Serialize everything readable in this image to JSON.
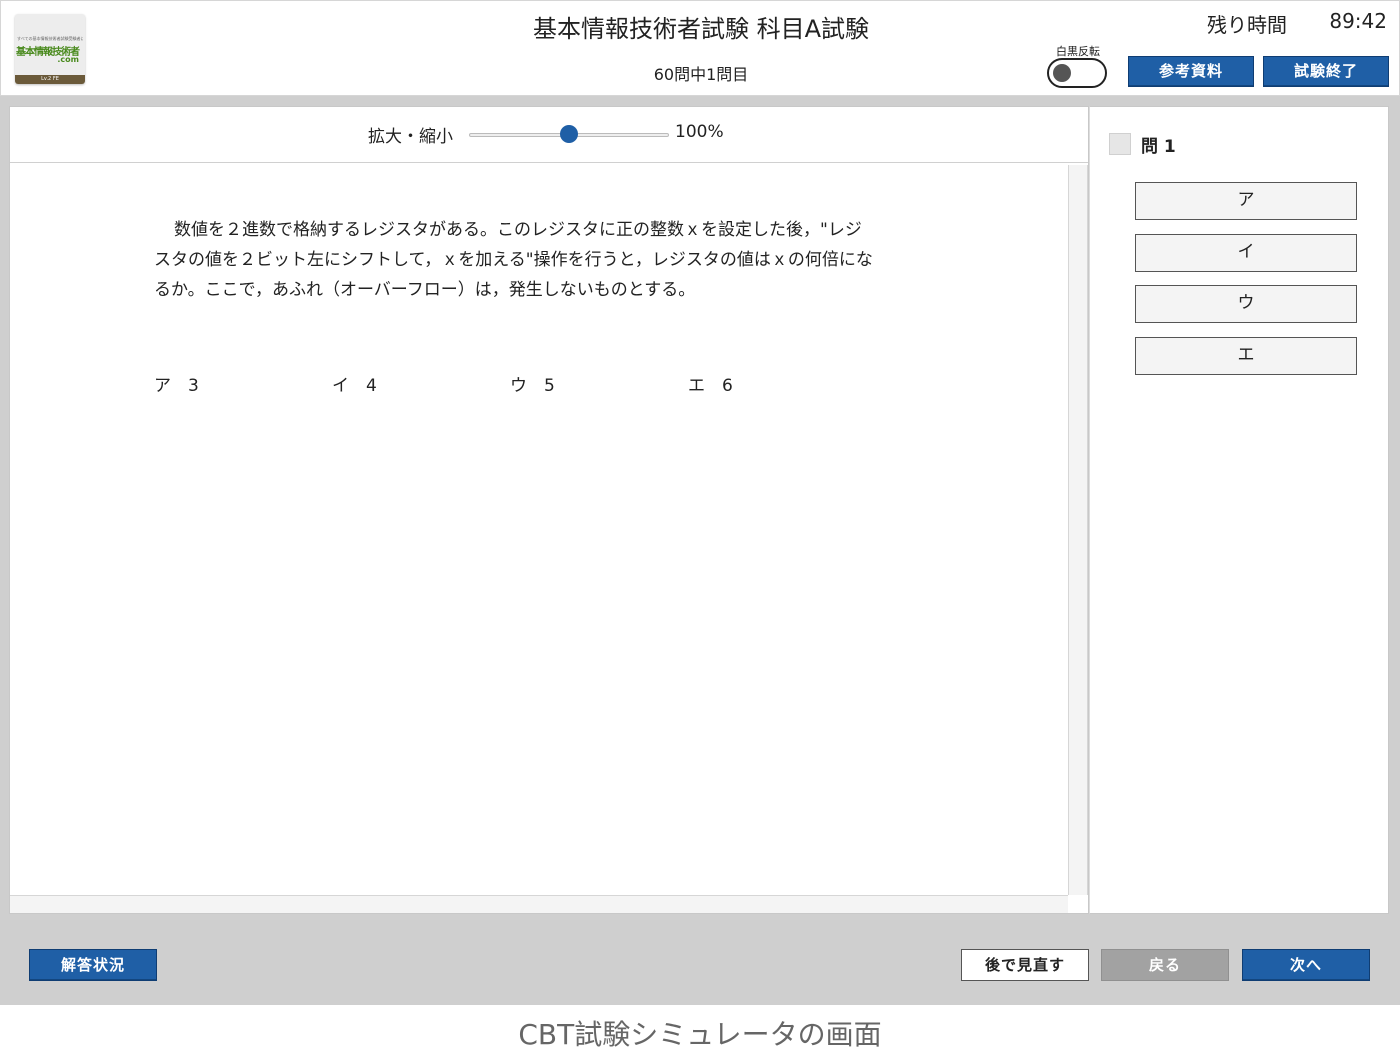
{
  "header": {
    "logo": {
      "small_text": "すべての基本情報技術者試験受験者に贈る",
      "main_text": "基本情報技術者",
      "domain_text": ".com",
      "foot_text": "Lv.2 FE"
    },
    "title": "基本情報技術者試験 科目A試験",
    "progress": "60問中1問目",
    "timer_label": "残り時間",
    "timer_value": "89:42",
    "invert_label": "白黒反転",
    "reference_button": "参考資料",
    "end_button": "試験終了"
  },
  "zoom": {
    "label": "拡大・縮小",
    "value": "100%",
    "percent": 100
  },
  "question": {
    "text": "数値を２進数で格納するレジスタがある。このレジスタに正の整数ｘを設定した後，\"レジスタの値を２ビット左にシフトして，ｘを加える\"操作を行うと，レジスタの値はｘの何倍になるか。ここで，あふれ（オーバーフロー）は，発生しないものとする。",
    "choices": [
      {
        "mark": "ア",
        "value": "3"
      },
      {
        "mark": "イ",
        "value": "4"
      },
      {
        "mark": "ウ",
        "value": "5"
      },
      {
        "mark": "エ",
        "value": "6"
      }
    ]
  },
  "side": {
    "question_label": "問 1",
    "answers": [
      "ア",
      "イ",
      "ウ",
      "エ"
    ]
  },
  "footer": {
    "status_button": "解答状況",
    "later_button": "後で見直す",
    "back_button": "戻る",
    "next_button": "次へ"
  },
  "caption": "CBT試験シミュレータの画面",
  "colors": {
    "primary_blue": "#1f5fa6",
    "disabled_gray": "#a2a2a2",
    "frame_gray": "#cfcfcf"
  }
}
